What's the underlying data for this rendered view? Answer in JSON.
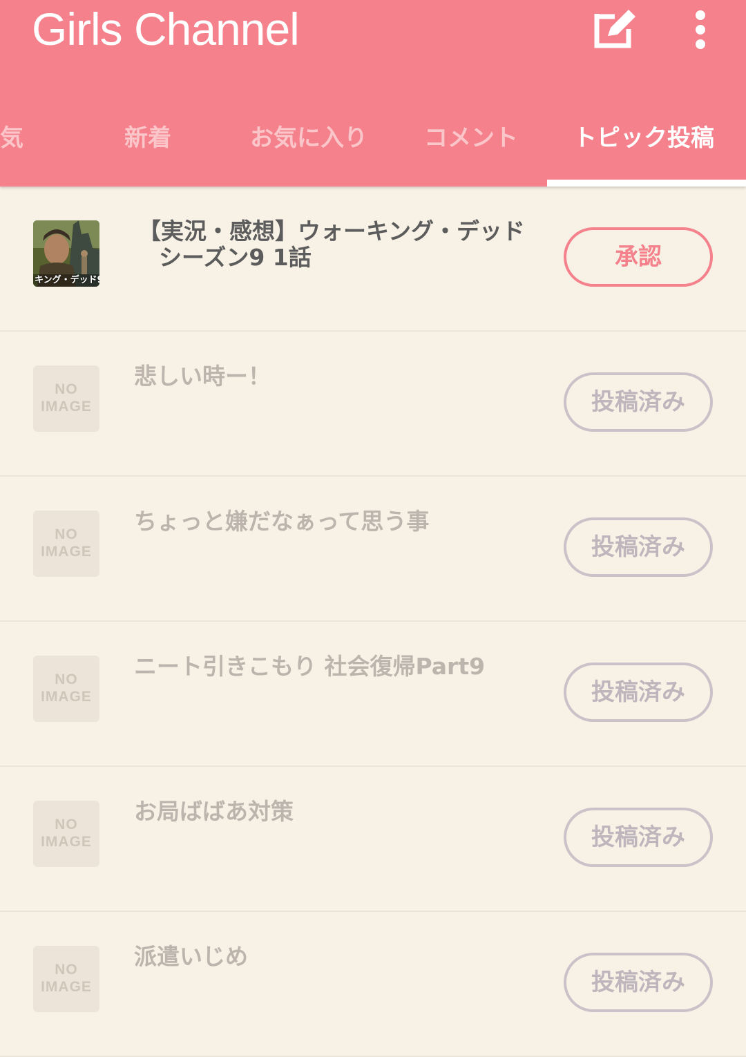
{
  "app": {
    "title": "Girls Channel",
    "accent_color": "#f4818b",
    "background_color": "#f8f2e6"
  },
  "header": {
    "icons": [
      "edit-icon",
      "more-vert-icon"
    ]
  },
  "tabs": [
    {
      "label": "気",
      "active": false
    },
    {
      "label": "新着",
      "active": false
    },
    {
      "label": "お気に入り",
      "active": false
    },
    {
      "label": "コメント",
      "active": false
    },
    {
      "label": "トピック投稿",
      "active": true
    }
  ],
  "list": {
    "items": [
      {
        "thumbnail": "photo",
        "thumbnail_caption": "キング・デッド9",
        "title_line1": "【実況・感想】ウォーキング・デッド",
        "title_line2": "シーズン9 1話",
        "button": "承認"
      },
      {
        "thumbnail": "no-image",
        "noimage_top": "NO",
        "noimage_bottom": "IMAGE",
        "title": "悲しい時ー！",
        "button": "投稿済み"
      },
      {
        "thumbnail": "no-image",
        "noimage_top": "NO",
        "noimage_bottom": "IMAGE",
        "title": "ちょっと嫌だなぁって思う事",
        "button": "投稿済み"
      },
      {
        "thumbnail": "no-image",
        "noimage_top": "NO",
        "noimage_bottom": "IMAGE",
        "title": "ニート引きこもり 社会復帰Part9",
        "button": "投稿済み"
      },
      {
        "thumbnail": "no-image",
        "noimage_top": "NO",
        "noimage_bottom": "IMAGE",
        "title": "お局ばばあ対策",
        "button": "投稿済み"
      },
      {
        "thumbnail": "no-image",
        "noimage_top": "NO",
        "noimage_bottom": "IMAGE",
        "title": "派遣いじめ",
        "button": "投稿済み"
      }
    ]
  }
}
